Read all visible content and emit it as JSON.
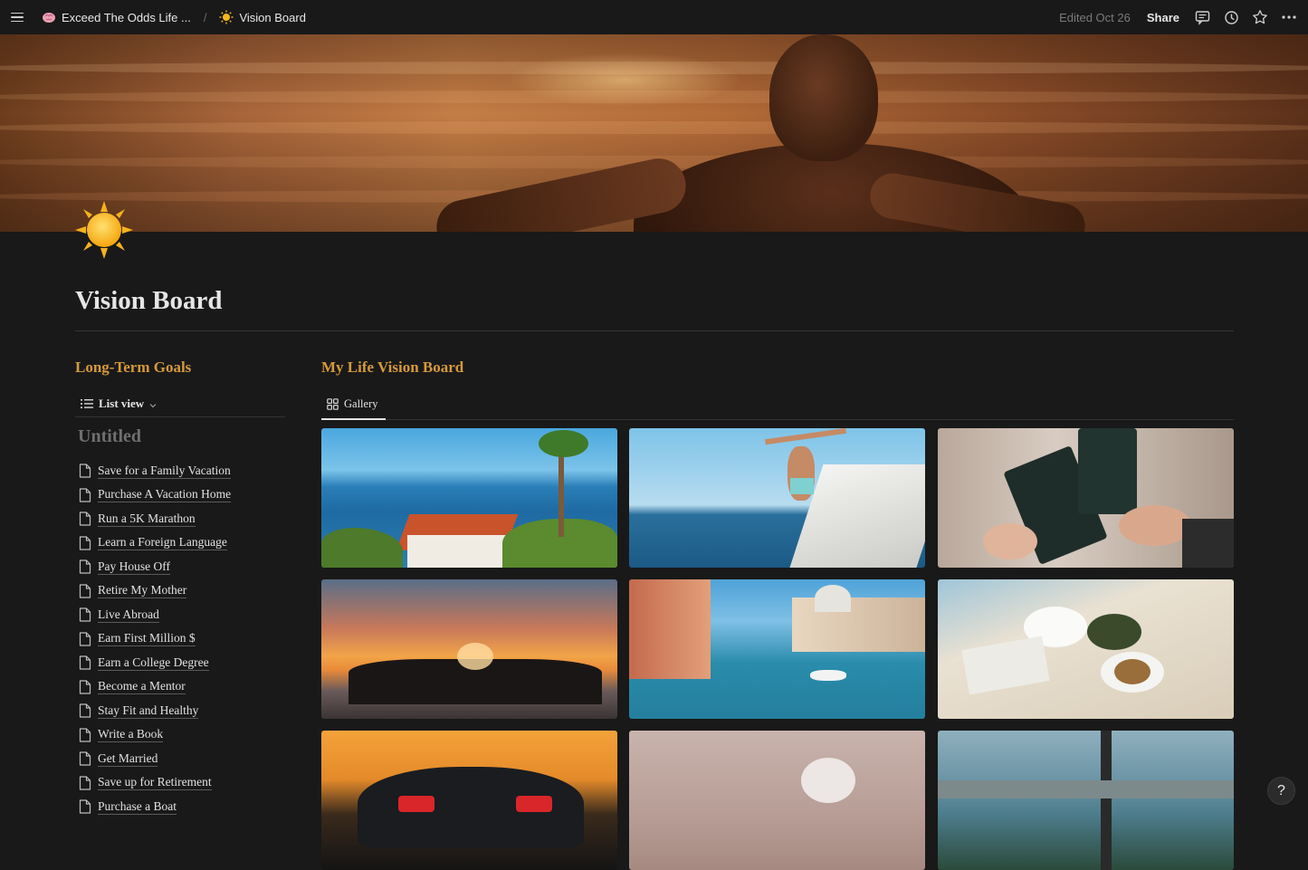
{
  "topbar": {
    "workspace_title": "Exceed The Odds Life ...",
    "separator": "/",
    "page_title": "Vision Board",
    "edited": "Edited Oct 26",
    "share_label": "Share",
    "icons": [
      "menu-icon",
      "brain-icon",
      "sun-icon",
      "comments-icon",
      "history-icon",
      "star-icon",
      "more-icon"
    ]
  },
  "page": {
    "title": "Vision Board"
  },
  "left": {
    "title": "Long-Term Goals",
    "view_label": "List view",
    "group_title": "Untitled",
    "items": [
      "Save for a Family Vacation",
      "Purchase A Vacation Home",
      "Run a 5K Marathon",
      "Learn a Foreign Language",
      "Pay House Off",
      "Retire My Mother",
      "Live Abroad",
      "Earn First Million $",
      "Earn a College Degree",
      "Become a Mentor",
      "Stay Fit and Healthy",
      "Write a Book",
      "Get Married",
      "Save up for Retirement",
      "Purchase a Boat"
    ]
  },
  "right": {
    "title": "My Life Vision Board",
    "tab_label": "Gallery"
  },
  "colors": {
    "background": "#191919",
    "heading_accent": "#d59a3a",
    "text": "#e2e2e2",
    "muted": "#6f6f6f"
  },
  "help_label": "?"
}
